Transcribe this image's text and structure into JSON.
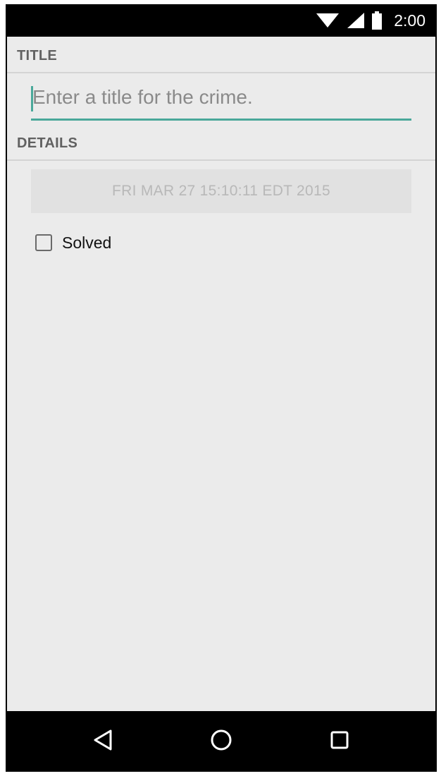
{
  "status_bar": {
    "time": "2:00",
    "icons": [
      "wifi-icon",
      "cell-signal-icon",
      "battery-icon"
    ]
  },
  "form": {
    "title_header": "TITLE",
    "title_placeholder": "Enter a title for the crime.",
    "title_value": "",
    "details_header": "DETAILS",
    "date_button_label": "FRI MAR 27 15:10:11 EDT 2015",
    "solved_label": "Solved",
    "solved_checked": false
  },
  "nav_bar": {
    "buttons": [
      "back-icon",
      "home-icon",
      "recents-icon"
    ]
  },
  "colors": {
    "accent": "#4aa89a",
    "background": "#ebebeb",
    "bar": "#000000",
    "header_text": "#616161",
    "date_button_bg": "#e1e1e1",
    "date_button_text": "#b8b8b8"
  }
}
